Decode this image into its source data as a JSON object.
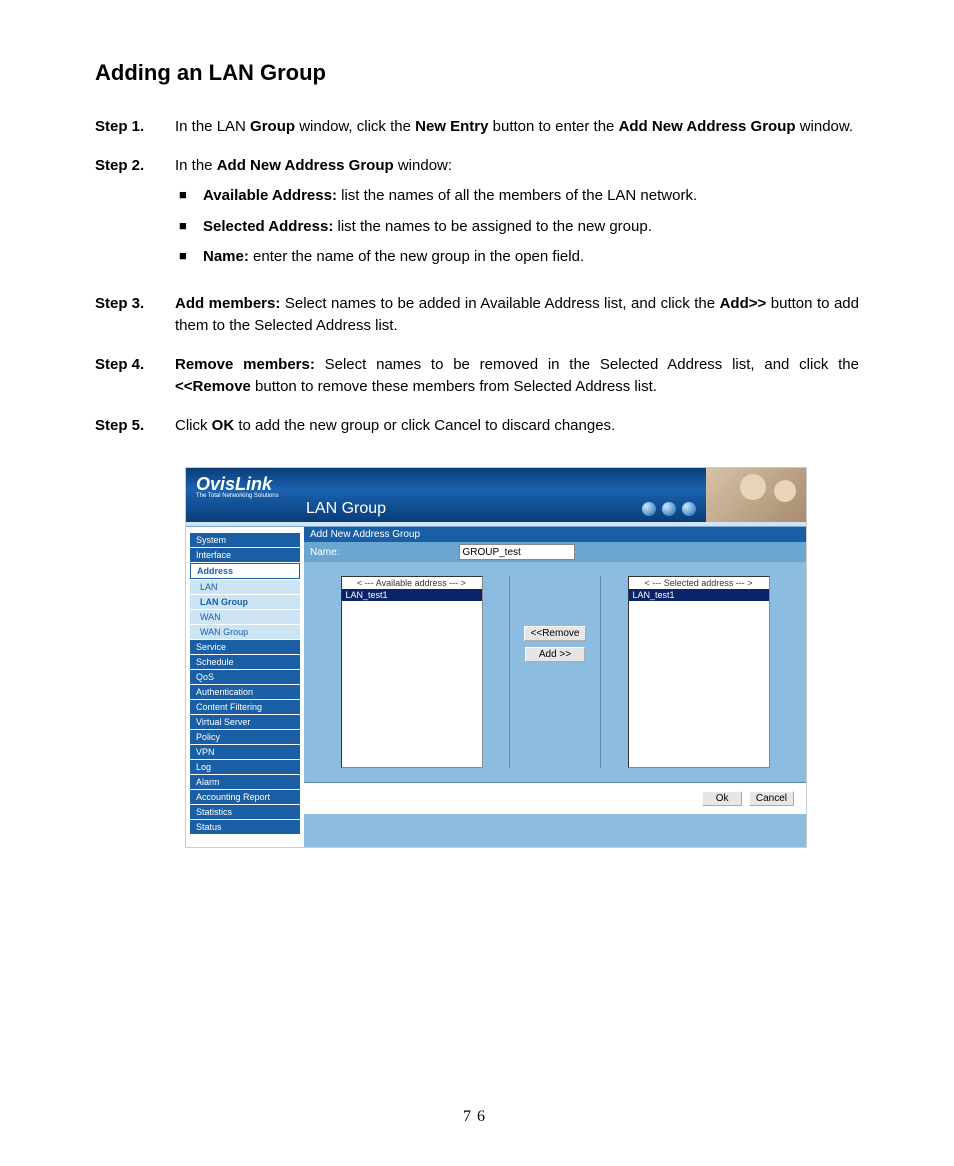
{
  "title": "Adding an LAN Group",
  "steps": {
    "s1": {
      "label": "Step 1.",
      "pre": "In the LAN ",
      "b1": "Group",
      "mid1": " window, click the ",
      "b2": "New Entry",
      "mid2": " button to enter the ",
      "b3": "Add New Address Group",
      "post": " window."
    },
    "s2": {
      "label": "Step 2.",
      "pre": "In the ",
      "b1": "Add New Address Group",
      "post": " window:",
      "bullets": {
        "a": {
          "b": "Available Address:",
          "t": " list the names of all the members of the LAN network."
        },
        "b": {
          "b": "Selected Address:",
          "t": " list the names to be assigned to the new group."
        },
        "c": {
          "b": "Name:",
          "t": " enter the name of the new group in the open field."
        }
      }
    },
    "s3": {
      "label": "Step 3.",
      "b1": "Add members:",
      "mid1": " Select names to be added in Available Address list, and click the ",
      "b2": "Add>>",
      "post": " button to add them to the Selected Address list."
    },
    "s4": {
      "label": "Step 4.",
      "b1": "Remove members:",
      "mid1": " Select names to be removed in the Selected Address list, and click the ",
      "b2": "<<Remove",
      "post": " button to remove these members from Selected Address list."
    },
    "s5": {
      "label": "Step 5.",
      "pre": "Click ",
      "b1": "OK",
      "post": " to add the new group or click Cancel to discard changes."
    }
  },
  "screenshot": {
    "logo": "OvisLink",
    "logo_sub": "The Total Networking Solutions",
    "page_title": "LAN Group",
    "nav": {
      "n0": "System",
      "n1": "Interface",
      "n2": "Address",
      "s0": "LAN",
      "s1": "LAN Group",
      "s2": "WAN",
      "s3": "WAN Group",
      "n3": "Service",
      "n4": "Schedule",
      "n5": "QoS",
      "n6": "Authentication",
      "n7": "Content Filtering",
      "n8": "Virtual Server",
      "n9": "Policy",
      "n10": "VPN",
      "n11": "Log",
      "n12": "Alarm",
      "n13": "Accounting Report",
      "n14": "Statistics",
      "n15": "Status"
    },
    "panel_header": "Add New Address Group",
    "name_label": "Name:",
    "name_value": "GROUP_test",
    "available_header": "< --- Available address --- >",
    "available_item": "LAN_test1",
    "selected_header": "< --- Selected address --- >",
    "selected_item": "LAN_test1",
    "btn_remove": "<<Remove",
    "btn_add": "Add  >>",
    "btn_ok": "Ok",
    "btn_cancel": "Cancel"
  },
  "page_number": "76"
}
